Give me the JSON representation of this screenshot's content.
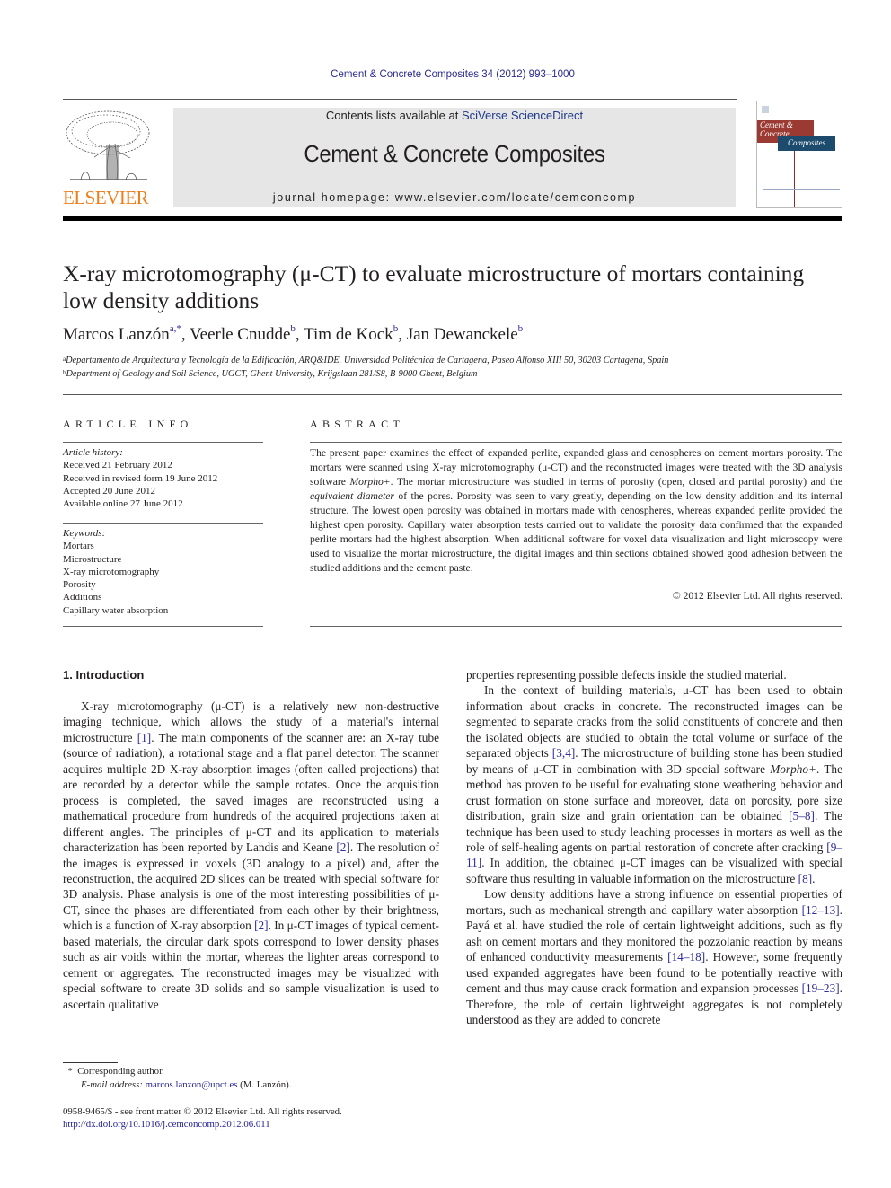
{
  "journal_citation": "Cement & Concrete Composites 34 (2012) 993–1000",
  "header": {
    "publisher": "ELSEVIER",
    "contents_prefix": "Contents lists available at ",
    "contents_link": "SciVerse ScienceDirect",
    "journal_name": "Cement & Concrete Composites",
    "homepage_prefix": "journal homepage: ",
    "homepage_url": "www.elsevier.com/locate/cemconcomp",
    "cover": {
      "line1": "Cement &",
      "line2": "Concrete",
      "line3": "Composites"
    }
  },
  "article": {
    "title": "X-ray microtomography (μ-CT) to evaluate microstructure of mortars containing low density additions",
    "authors": [
      {
        "name": "Marcos Lanzón",
        "sup": "a,*"
      },
      {
        "name": "Veerle Cnudde",
        "sup": "b"
      },
      {
        "name": "Tim de Kock",
        "sup": "b"
      },
      {
        "name": "Jan Dewanckele",
        "sup": "b"
      }
    ],
    "affiliations": [
      {
        "key": "a",
        "text": "Departamento de Arquitectura y Tecnología de la Edificación, ARQ&IDE. Universidad Politécnica de Cartagena, Paseo Alfonso XIII 50, 30203 Cartagena, Spain"
      },
      {
        "key": "b",
        "text": "Department of Geology and Soil Science, UGCT, Ghent University, Krijgslaan 281/S8, B-9000 Ghent, Belgium"
      }
    ]
  },
  "article_info": {
    "heading": "ARTICLE INFO",
    "history_label": "Article history:",
    "history": [
      "Received 21 February 2012",
      "Received in revised form 19 June 2012",
      "Accepted 20 June 2012",
      "Available online 27 June 2012"
    ],
    "keywords_label": "Keywords:",
    "keywords": [
      "Mortars",
      "Microstructure",
      "X-ray microtomography",
      "Porosity",
      "Additions",
      "Capillary water absorption"
    ]
  },
  "abstract": {
    "heading": "ABSTRACT",
    "parts": [
      "The present paper examines the effect of expanded perlite, expanded glass and cenospheres on cement mortars porosity. The mortars were scanned using X-ray microtomography (μ-CT) and the reconstructed images were treated with the 3D analysis software ",
      "Morpho+",
      ". The mortar microstructure was studied in terms of porosity (open, closed and partial porosity) and the ",
      "equivalent diameter",
      " of the pores. Porosity was seen to vary greatly, depending on the low density addition and its internal structure. The lowest open porosity was obtained in mortars made with cenospheres, whereas expanded perlite provided the highest open porosity. Capillary water absorption tests carried out to validate the porosity data confirmed that the expanded perlite mortars had the highest absorption. When additional software for voxel data visualization and light microscopy were used to visualize the mortar microstructure, the digital images and thin sections obtained showed good adhesion between the studied additions and the cement paste."
    ],
    "copyright": "© 2012 Elsevier Ltd. All rights reserved."
  },
  "body": {
    "section_heading": "1. Introduction",
    "left_column": {
      "p1": [
        "X-ray microtomography (μ-CT) is a relatively new non-destructive imaging technique, which allows the study of a material's internal microstructure ",
        "[1]",
        ". The main components of the scanner are: an X-ray tube (source of radiation), a rotational stage and a flat panel detector. The scanner acquires multiple 2D X-ray absorption images (often called projections) that are recorded by a detector while the sample rotates. Once the acquisition process is completed, the saved images are reconstructed using a mathematical procedure from hundreds of the acquired projections taken at different angles. The principles of μ-CT and its application to materials characterization has been reported by Landis and Keane ",
        "[2]",
        ". The resolution of the images is expressed in voxels (3D analogy to a pixel) and, after the reconstruction, the acquired 2D slices can be treated with special software for 3D analysis. Phase analysis is one of the most interesting possibilities of μ-CT, since the phases are differentiated from each other by their brightness, which is a function of X-ray absorption ",
        "[2]",
        ". In μ-CT images of typical cement-based materials, the circular dark spots correspond to lower density phases such as air voids within the mortar, whereas the lighter areas correspond to cement or aggregates. The reconstructed images may be visualized with special software to create 3D solids and so sample visualization is used to ascertain qualitative"
      ]
    },
    "right_column": {
      "p0": "properties representing possible defects inside the studied material.",
      "p1": [
        "In the context of building materials, μ-CT has been used to obtain information about cracks in concrete. The reconstructed images can be segmented to separate cracks from the solid constituents of concrete and then the isolated objects are studied to obtain the total volume or surface of the separated objects ",
        "[3,4]",
        ". The microstructure of building stone has been studied by means of μ-CT in combination with 3D special software ",
        "Morpho+",
        ". The method has proven to be useful for evaluating stone weathering behavior and crust formation on stone surface and moreover, data on porosity, pore size distribution, grain size and grain orientation can be obtained ",
        "[5–8]",
        ". The technique has been used to study leaching processes in mortars as well as the role of self-healing agents on partial restoration of concrete after cracking ",
        "[9–11]",
        ". In addition, the obtained μ-CT images can be visualized with special software thus resulting in valuable information on the microstructure ",
        "[8]",
        "."
      ],
      "p2": [
        "Low density additions have a strong influence on essential properties of mortars, such as mechanical strength and capillary water absorption ",
        "[12–13]",
        ". Payá et al. have studied the role of certain lightweight additions, such as fly ash on cement mortars and they monitored the pozzolanic reaction by means of enhanced conductivity measurements ",
        "[14–18]",
        ". However, some frequently used expanded aggregates have been found to be potentially reactive with cement and thus may cause crack formation and expansion processes ",
        "[19–23]",
        ". Therefore, the role of certain lightweight aggregates is not completely understood as they are added to concrete"
      ]
    }
  },
  "footnote": {
    "marker": "*",
    "corresponding": "Corresponding author.",
    "email_label": "E-mail address: ",
    "email": "marcos.lanzon@upct.es",
    "email_suffix": " (M. Lanzón)."
  },
  "issn": {
    "line": "0958-9465/$ - see front matter © 2012 Elsevier Ltd. All rights reserved.",
    "doi": "http://dx.doi.org/10.1016/j.cemconcomp.2012.06.011"
  }
}
